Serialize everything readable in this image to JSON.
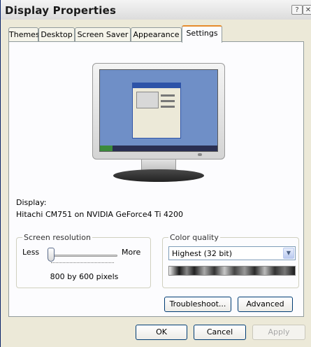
{
  "window": {
    "title": "Display Properties",
    "help_glyph": "?",
    "close_glyph": "✕"
  },
  "tabs": [
    {
      "label": "Themes",
      "active": false
    },
    {
      "label": "Desktop",
      "active": false
    },
    {
      "label": "Screen Saver",
      "active": false
    },
    {
      "label": "Appearance",
      "active": false
    },
    {
      "label": "Settings",
      "active": true
    }
  ],
  "settings": {
    "display_label": "Display:",
    "display_value": "Hitachi CM751 on NVIDIA GeForce4 Ti 4200",
    "screen_resolution": {
      "legend": "Screen resolution",
      "less_label": "Less",
      "more_label": "More",
      "value_text": "800 by 600 pixels",
      "slider_level": 0
    },
    "color_quality": {
      "legend": "Color quality",
      "selected": "Highest (32 bit)"
    },
    "troubleshoot_label": "Troubleshoot...",
    "advanced_label": "Advanced"
  },
  "buttons": {
    "ok": "OK",
    "cancel": "Cancel",
    "apply": "Apply"
  },
  "icons": {
    "help": "help-icon",
    "close": "close-icon",
    "dropdown": "chevron-down-icon"
  },
  "colors": {
    "active_tab_accent": "#e68b2c",
    "button_border": "#003c74",
    "disabled_text": "#a8a8a8"
  }
}
